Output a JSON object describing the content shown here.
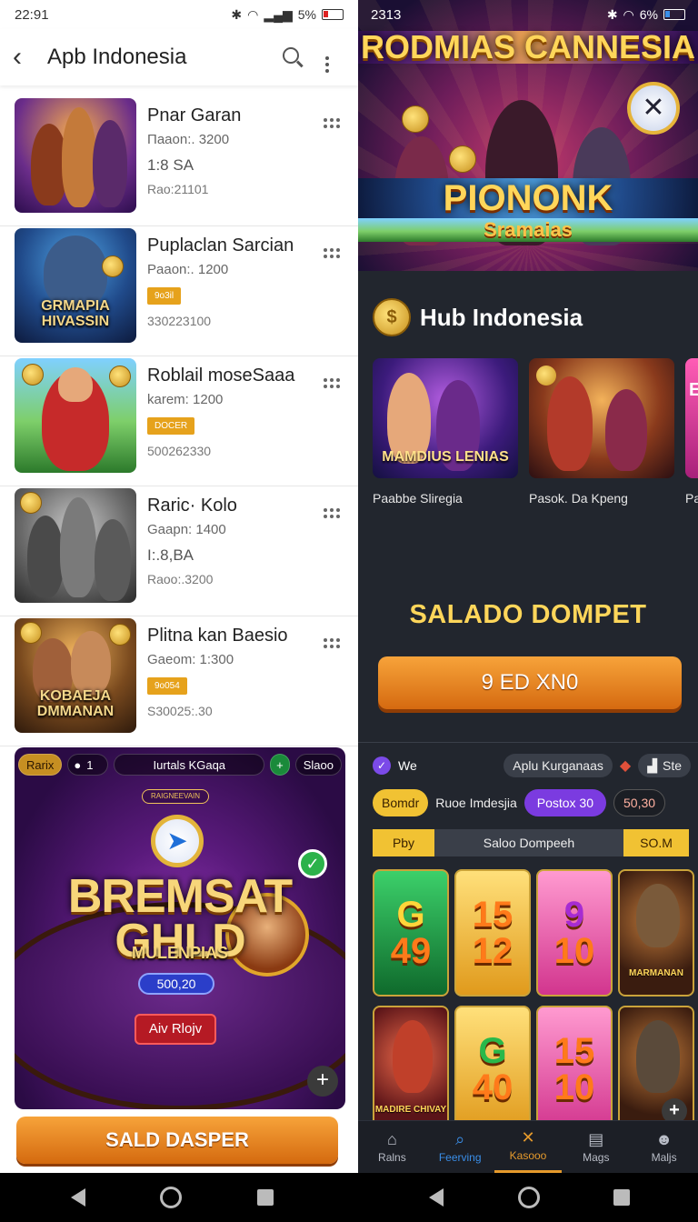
{
  "left_status": {
    "time": "22:91",
    "battery": "5%"
  },
  "left_appbar": {
    "title": "Apb Indonesia"
  },
  "games": [
    {
      "name": "Pnar Garan",
      "line2": "Πaaon:. 3200",
      "line3": "1:8 SA",
      "line4": "Rao:21101",
      "badge": "",
      "thumb_label": ""
    },
    {
      "name": "Puplaclan Sarcian",
      "line2": "Paaon:. 1200",
      "line3": "",
      "line4": "330223100",
      "badge": "9o3il",
      "thumb_label": "GRMAPIA HIVASSIN"
    },
    {
      "name": "Roblail moseSaaa",
      "line2": "karem: 1200",
      "line3": "",
      "line4": "500262330",
      "badge": "DOCER",
      "thumb_label": ""
    },
    {
      "name": "Raric· Kolo",
      "line2": "Gaapn: 1400",
      "line3": "I:.8,BA",
      "line4": "Raoo:.3200",
      "badge": "",
      "thumb_label": ""
    },
    {
      "name": "Plitna kan Baesio",
      "line2": "Gaeom: 1:300",
      "line3": "",
      "line4": "S30025:.30",
      "badge": "9o054",
      "thumb_label": "KOBAEJA DMMANAN"
    }
  ],
  "promo": {
    "top_pill_1": "Rarix",
    "top_count": "1",
    "top_pill_2": "Iurtals KGaqa",
    "top_pill_3": "Slaoo",
    "small_sign": "RAIGNEEVAIN",
    "title": "BREMSAT GHLD",
    "subtitle": "MULENPIAS",
    "amount": "500,20",
    "cta": "Aiv Rlojv"
  },
  "left_bottom_button": "SALD DASPER",
  "right_status": {
    "time": "2313",
    "battery": "6%"
  },
  "banner": {
    "title": "RODMIAS CANNESIA",
    "headline": "PIONONK",
    "subline": "Sramaias"
  },
  "hub": {
    "title": "Hub Indonesia",
    "cards": [
      {
        "caption": "Paabbe Sliregia",
        "label": "MAMDIUS LENIAS"
      },
      {
        "caption": "Pasok. Da Kpeng",
        "label": ""
      },
      {
        "caption": "Pa",
        "label": "E"
      }
    ]
  },
  "saldo": {
    "title": "SALADO DOMPET",
    "button": "9 ED XN0"
  },
  "chips": {
    "chip1": "We",
    "chip2": "Aplu Kurganaas",
    "chip3": "Ste"
  },
  "pills": {
    "gold": "Bomdr",
    "text": "Ruoe Imdesjia",
    "purple": "Postox 30",
    "dark": "50,30"
  },
  "wallet": {
    "left": "Pby",
    "mid": "Saloo Dompeeh",
    "right": "SO.M"
  },
  "slots": [
    {
      "top": "G",
      "bottom": "49",
      "style": "green",
      "label": ""
    },
    {
      "top": "15",
      "bottom": "12",
      "style": "gold",
      "label": ""
    },
    {
      "top": "9",
      "bottom": "10",
      "style": "pink",
      "label": ""
    },
    {
      "top": "",
      "bottom": "",
      "style": "dark",
      "label": "MARMANAN"
    },
    {
      "top": "",
      "bottom": "",
      "style": "red",
      "label": "MADIRE CHIVAY"
    },
    {
      "top": "G",
      "bottom": "40",
      "style": "gold",
      "label": ""
    },
    {
      "top": "15",
      "bottom": "10",
      "style": "pink",
      "label": ""
    },
    {
      "top": "",
      "bottom": "",
      "style": "dark",
      "label": ""
    }
  ],
  "tabs": [
    {
      "label": "Ralns",
      "icon": "home-icon"
    },
    {
      "label": "Feerving",
      "icon": "search-icon"
    },
    {
      "label": "Kasooo",
      "icon": "casino-icon"
    },
    {
      "label": "Mags",
      "icon": "book-icon"
    },
    {
      "label": "Maljs",
      "icon": "profile-icon"
    }
  ]
}
